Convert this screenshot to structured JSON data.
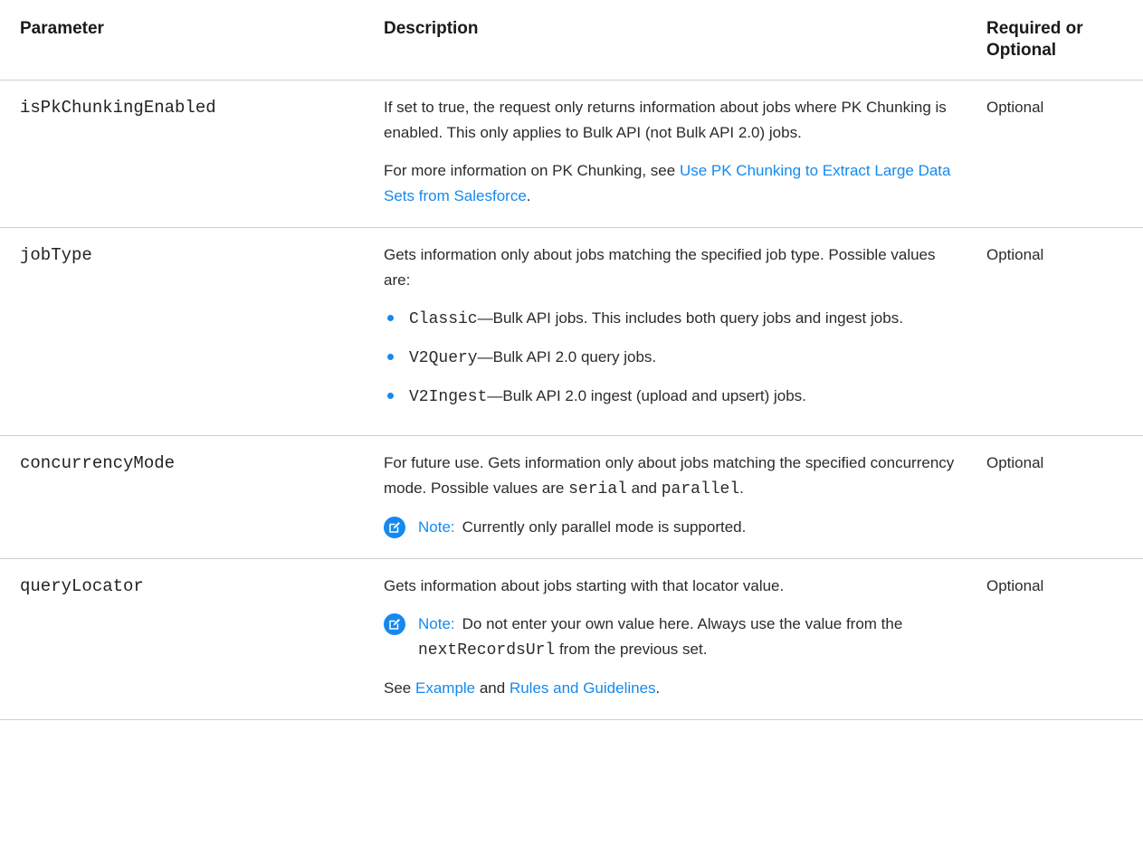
{
  "header": {
    "parameter": "Parameter",
    "description": "Description",
    "required": "Required or Optional"
  },
  "rows": [
    {
      "name": "isPkChunkingEnabled",
      "desc": "If set to true, the request only returns information about jobs where PK Chunking is enabled. This only applies to Bulk API (not Bulk API 2.0) jobs.",
      "more_prefix": "For more information on PK Chunking, see ",
      "more_link": "Use PK Chunking to Extract Large Data Sets from Salesforce",
      "more_suffix": ".",
      "req": "Optional"
    },
    {
      "name": "jobType",
      "desc": "Gets information only about jobs matching the specified job type. Possible values are:",
      "values": [
        {
          "code": "Classic",
          "text": "—Bulk API jobs. This includes both query jobs and ingest jobs."
        },
        {
          "code": "V2Query",
          "text": "—Bulk API 2.0 query jobs."
        },
        {
          "code": "V2Ingest",
          "text": "—Bulk API 2.0 ingest (upload and upsert) jobs."
        }
      ],
      "req": "Optional"
    },
    {
      "name": "concurrencyMode",
      "desc_prefix": "For future use. Gets information only about jobs matching the specified concurrency mode. Possible values are ",
      "code1": "serial",
      "desc_mid": " and ",
      "code2": "parallel",
      "desc_suffix": ".",
      "note_label": "Note:",
      "note_text": "Currently only parallel mode is supported.",
      "req": "Optional"
    },
    {
      "name": "queryLocator",
      "desc": "Gets information about jobs starting with that locator value.",
      "note_label": "Note:",
      "note_prefix": "Do not enter your own value here. Always use the value from the ",
      "note_code": "nextRecordsUrl",
      "note_suffix": " from the previous set.",
      "see_prefix": "See ",
      "link1": "Example",
      "see_mid": " and ",
      "link2": "Rules and Guidelines",
      "see_suffix": ".",
      "req": "Optional"
    }
  ],
  "icons": {
    "note": "edit-note-icon",
    "bullet": "bullet-dot"
  },
  "colors": {
    "link": "#1589ee",
    "accent": "#1589ee",
    "text": "#2b2b2b",
    "border": "#cfcfcf"
  }
}
